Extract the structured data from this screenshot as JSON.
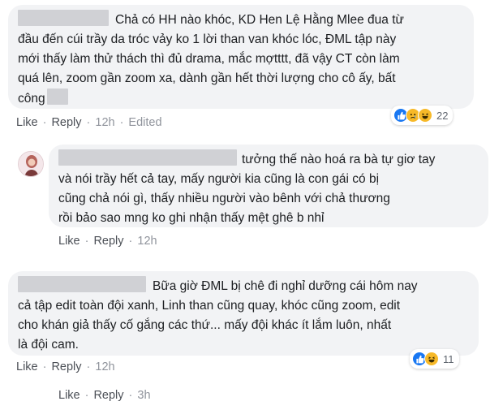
{
  "comments": [
    {
      "text_lines": [
        "Chả có HH nào khóc, KD Hen Lệ Hằng Mlee đua từ",
        "đầu đến cúi trầy da tróc vảy ko 1 lời than van khóc lóc, ĐML tập này",
        "mới thấy làm thử thách thì đủ drama, mắc mợtttt, đã vậy CT còn làm",
        "quá lên, zoom gần zoom xa, dành gần hết thời lượng cho cô ấy, bất",
        "công"
      ],
      "like": "Like",
      "reply": "Reply",
      "time": "12h",
      "edited": "Edited",
      "reaction_count": "22"
    },
    {
      "text_lines": [
        "tưởng thế nào hoá ra bà tự giơ tay",
        "và nói trầy hết cả tay, mấy người kia cũng là con gái có bị",
        "cũng chả nói gì, thấy nhiều người vào bênh với chả thương",
        "rồi bảo sao mng ko ghi nhận thấy mệt ghê b nhỉ"
      ],
      "like": "Like",
      "reply": "Reply",
      "time": "12h"
    },
    {
      "text_lines": [
        "Bữa giờ ĐML bị chê đi nghỉ dưỡng cái hôm nay",
        "cả tập edit toàn đội xanh, Linh than cũng quay, khóc cũng zoom, edit",
        "cho khán giả thấy cố gắng các thứ... mấy đội khác ít lắm luôn, nhất",
        "là đội cam."
      ],
      "like": "Like",
      "reply": "Reply",
      "time": "12h",
      "reaction_count": "11"
    },
    {
      "like": "Like",
      "reply": "Reply",
      "time": "3h"
    }
  ],
  "icons": {
    "like": "like-icon",
    "sad": "sad-icon",
    "haha": "haha-icon"
  },
  "colors": {
    "bubble": "#f2f3f5",
    "like_blue": "#1877f2",
    "emoji_yellow": "#f7b928",
    "meta_text": "#616770"
  }
}
